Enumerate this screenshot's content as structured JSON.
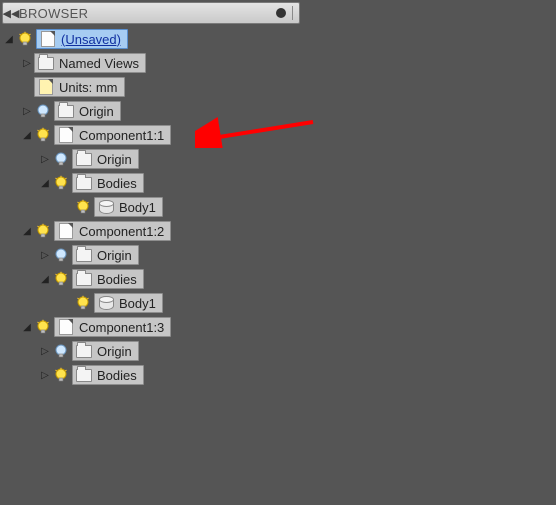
{
  "header": {
    "title": "BROWSER"
  },
  "tree": {
    "root": {
      "label": "(Unsaved)"
    },
    "namedViews": {
      "label": "Named Views"
    },
    "units": {
      "label": "Units: mm"
    },
    "origin": {
      "label": "Origin"
    },
    "comp1": {
      "label": "Component1:1",
      "origin": "Origin",
      "bodies": {
        "label": "Bodies",
        "body1": "Body1"
      }
    },
    "comp2": {
      "label": "Component1:2",
      "origin": "Origin",
      "bodies": {
        "label": "Bodies",
        "body1": "Body1"
      }
    },
    "comp3": {
      "label": "Component1:3",
      "origin": "Origin",
      "bodies": {
        "label": "Bodies"
      }
    }
  }
}
